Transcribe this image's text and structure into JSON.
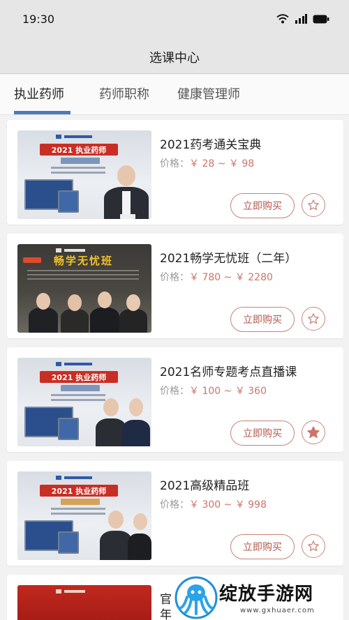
{
  "status_bar": {
    "time": "19:30"
  },
  "header": {
    "title": "选课中心"
  },
  "tabs": [
    {
      "label": "执业药师",
      "active": true
    },
    {
      "label": "药师职称",
      "active": false
    },
    {
      "label": "健康管理师",
      "active": false
    }
  ],
  "price_label": "价格：",
  "buy_label": "立即购买",
  "courses": [
    {
      "title": "2021药考通关宝典",
      "price": "￥ 28 ~ ￥ 98",
      "favorited": false,
      "poster_title": "2021 执业药师"
    },
    {
      "title": "2021畅学无忧班（二年）",
      "price": "￥ 780 ~ ￥ 2280",
      "favorited": false,
      "poster_title": "畅学无忧班"
    },
    {
      "title": "2021名师专题考点直播课",
      "price": "￥ 100 ~ ￥ 360",
      "favorited": true,
      "poster_title": "2021 执业药师"
    },
    {
      "title": "2021高级精品班",
      "price": "￥ 300 ~ ￥ 998",
      "favorited": false,
      "poster_title": "2021 执业药师"
    }
  ],
  "partial_course": {
    "title_line1": "官",
    "title_line2": "年"
  },
  "watermark": {
    "text": "绽放手游网",
    "url": "www.gxhuaer.com"
  },
  "colors": {
    "accent_blue": "#4b7bb5",
    "price_red": "#c9756b",
    "button_border": "#c78276",
    "fav_fill": "#c9756b"
  }
}
